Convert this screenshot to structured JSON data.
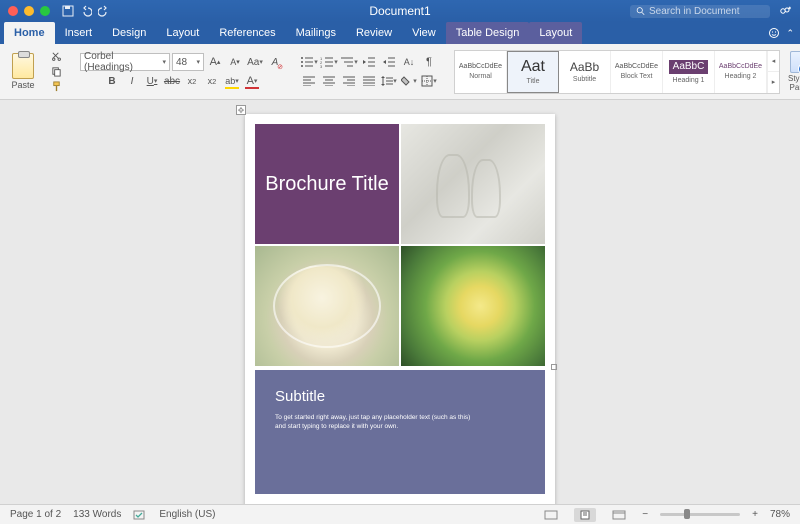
{
  "title": "Document1",
  "search": {
    "placeholder": "Search in Document"
  },
  "tabs": [
    "Home",
    "Insert",
    "Design",
    "Layout",
    "References",
    "Mailings",
    "Review",
    "View",
    "Table Design",
    "Layout"
  ],
  "active_tab": 0,
  "clipboard": {
    "paste": "Paste"
  },
  "font": {
    "name": "Corbel (Headings)",
    "size": "48",
    "bold": "B",
    "italic": "I",
    "underline": "U",
    "strike": "abc",
    "sub": "x",
    "sup": "x",
    "increase": "A",
    "decrease": "A",
    "clear": "A",
    "case": "Aa",
    "highlight": "ab",
    "fontcolor": "A"
  },
  "styles": {
    "items": [
      {
        "sample": "AaBbCcDdEe",
        "name": "Normal"
      },
      {
        "sample": "Aat",
        "name": "Title"
      },
      {
        "sample": "AaBb",
        "name": "Subtitle"
      },
      {
        "sample": "AaBbCcDdEe",
        "name": "Block Text"
      },
      {
        "sample": "AaBbC",
        "name": "Heading 1"
      },
      {
        "sample": "AaBbCcDdEe",
        "name": "Heading 2"
      }
    ],
    "pane": "Styles Pane"
  },
  "document": {
    "brochure_title": "Brochure Title",
    "subtitle": "Subtitle",
    "body": "To get started right away, just tap any placeholder text (such as this) and start typing to replace it with your own."
  },
  "status": {
    "page": "Page 1 of 2",
    "words": "133 Words",
    "lang": "English (US)",
    "zoom": "78%"
  },
  "colors": {
    "title_cell": "#6b3f70",
    "subtitle_block": "#6a6f9a"
  }
}
